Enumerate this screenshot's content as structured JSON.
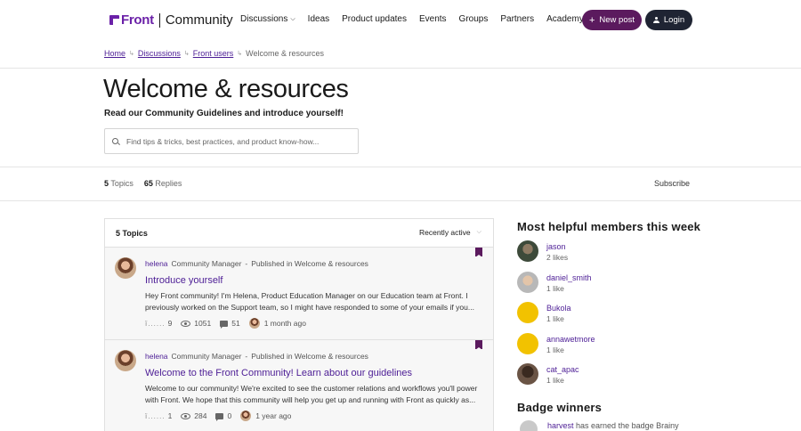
{
  "header": {
    "logo_brand": "Front",
    "logo_product": "Community",
    "nav": [
      {
        "label": "Discussions",
        "has_dropdown": true
      },
      {
        "label": "Ideas"
      },
      {
        "label": "Product updates"
      },
      {
        "label": "Events"
      },
      {
        "label": "Groups"
      },
      {
        "label": "Partners"
      },
      {
        "label": "Academy"
      }
    ],
    "new_post_label": "New post",
    "login_label": "Login"
  },
  "breadcrumb": {
    "items": [
      "Home",
      "Discussions",
      "Front users"
    ],
    "current": "Welcome & resources"
  },
  "category": {
    "title": "Welcome & resources",
    "subtitle": "Read our Community Guidelines and introduce yourself!",
    "search_placeholder": "Find tips & tricks, best practices, and product know-how..."
  },
  "stats": {
    "topics_count": "5",
    "topics_label": "Topics",
    "replies_count": "65",
    "replies_label": "Replies",
    "subscribe_label": "Subscribe"
  },
  "list": {
    "header_count": "5 Topics",
    "sort_label": "Recently active",
    "topics": [
      {
        "author": "helena",
        "role": "Community Manager",
        "sep": "-",
        "published": "Published in Welcome & resources",
        "title": "Introduce yourself",
        "excerpt": "Hey Front community! I'm Helena, Product Education Manager on our Education team at Front. I previously worked on the Support team, so I might have responded to some of your emails if you...",
        "likes": "9",
        "views": "1051",
        "replies": "51",
        "last_activity": "1 month ago"
      },
      {
        "author": "helena",
        "role": "Community Manager",
        "sep": "-",
        "published": "Published in Welcome & resources",
        "title": "Welcome to the Front Community! Learn about our guidelines",
        "excerpt": "Welcome to our community! We're excited to see the customer relations and workflows you'll power with Front. We hope that this community will help you get up and running with Front as quickly as...",
        "likes": "1",
        "views": "284",
        "replies": "0",
        "last_activity": "1 year ago"
      }
    ]
  },
  "sidebar": {
    "helpful_title": "Most helpful members this week",
    "members": [
      {
        "name": "jason",
        "likes": "2 likes"
      },
      {
        "name": "daniel_smith",
        "likes": "1 like"
      },
      {
        "name": "Bukola",
        "likes": "1 like"
      },
      {
        "name": "annawetmore",
        "likes": "1 like"
      },
      {
        "name": "cat_apac",
        "likes": "1 like"
      }
    ],
    "badge_title": "Badge winners",
    "badge_user": "harvest",
    "badge_text": "has earned the badge Brainy"
  },
  "colors": {
    "brand_purple": "#6b21a8",
    "link_purple": "#4c1d95",
    "new_post_bg": "#5b1a5e",
    "login_bg": "#1f2433"
  }
}
